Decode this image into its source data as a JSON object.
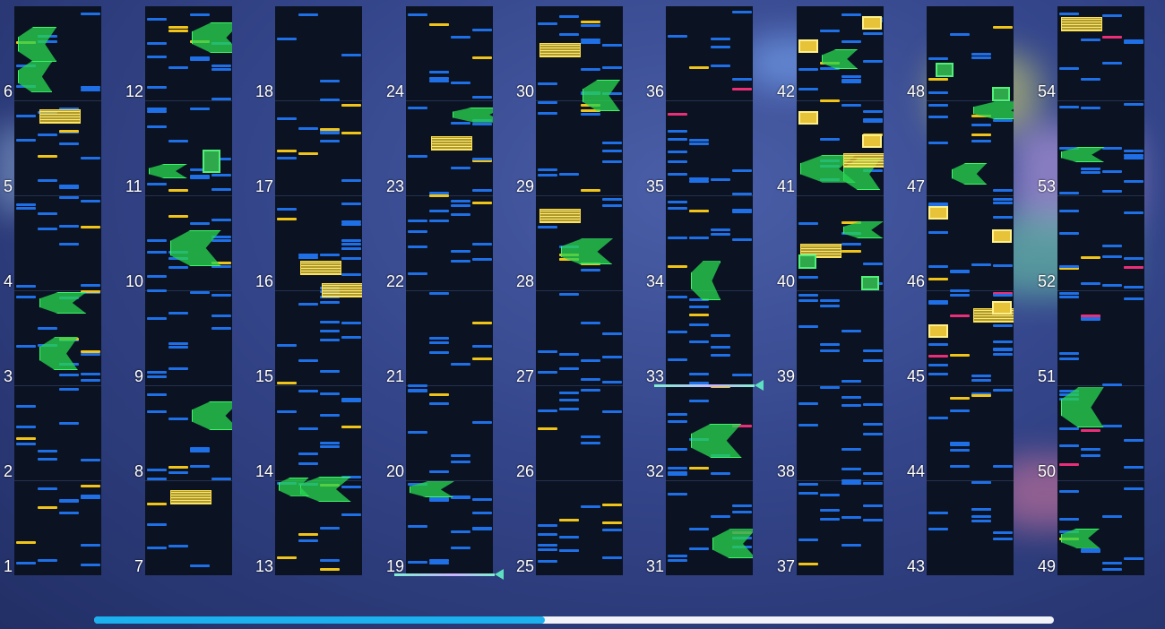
{
  "view": "chart-overview",
  "colors": {
    "tap": "#1f6fe6",
    "flick": "#f0c419",
    "critical": "#ea2f78",
    "hold": "#3ef56a",
    "background": "#0b1222"
  },
  "columns": [
    {
      "first": 1,
      "last": 6,
      "labels": [
        "1",
        "2",
        "3",
        "4",
        "5",
        "6"
      ]
    },
    {
      "first": 7,
      "last": 12,
      "labels": [
        "7",
        "8",
        "9",
        "10",
        "11",
        "12"
      ]
    },
    {
      "first": 13,
      "last": 18,
      "labels": [
        "13",
        "14",
        "15",
        "16",
        "17",
        "18"
      ]
    },
    {
      "first": 19,
      "last": 24,
      "labels": [
        "19",
        "20",
        "21",
        "22",
        "23",
        "24"
      ]
    },
    {
      "first": 25,
      "last": 30,
      "labels": [
        "25",
        "26",
        "27",
        "28",
        "29",
        "30"
      ]
    },
    {
      "first": 31,
      "last": 36,
      "labels": [
        "31",
        "32",
        "33",
        "34",
        "35",
        "36"
      ]
    },
    {
      "first": 37,
      "last": 42,
      "labels": [
        "37",
        "38",
        "39",
        "40",
        "41",
        "42"
      ]
    },
    {
      "first": 43,
      "last": 48,
      "labels": [
        "43",
        "44",
        "45",
        "46",
        "47",
        "48"
      ]
    },
    {
      "first": 49,
      "last": 54,
      "labels": [
        "49",
        "50",
        "51",
        "52",
        "53",
        "54"
      ]
    }
  ],
  "playhead": {
    "measure": "19",
    "column": 3
  },
  "scroll_progress": 0.47
}
